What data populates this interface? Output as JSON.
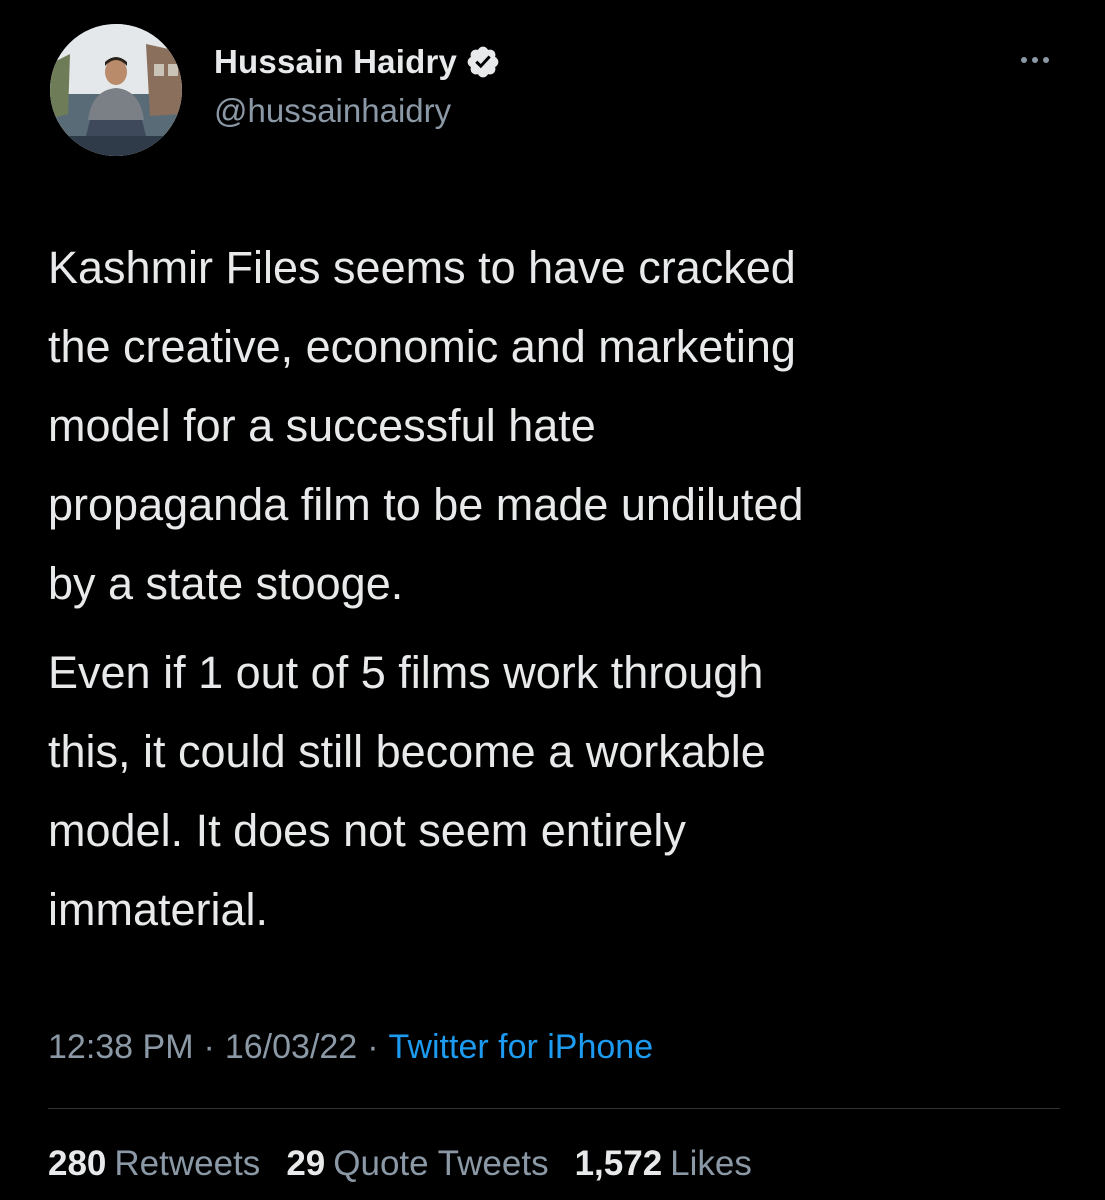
{
  "author": {
    "display_name": "Hussain Haidry",
    "handle": "@hussainhaidry",
    "verified_icon": "verified-badge-icon"
  },
  "menu": {
    "icon": "more-options-icon"
  },
  "tweet": {
    "paragraphs": [
      "Kashmir Files seems to have cracked\nthe creative, economic and marketing\nmodel for a successful hate\npropaganda film to be made undiluted\nby a state stooge.",
      "Even if 1 out of 5 films work through\nthis, it could still become a workable\nmodel. It does not seem entirely\nimmaterial."
    ]
  },
  "meta": {
    "time": "12:38 PM",
    "separator": "·",
    "date": "16/03/22",
    "source": "Twitter for iPhone"
  },
  "stats": {
    "retweets": {
      "count": "280",
      "label": "Retweets"
    },
    "quote_tweets": {
      "count": "29",
      "label": "Quote Tweets"
    },
    "likes": {
      "count": "1,572",
      "label": "Likes"
    }
  },
  "colors": {
    "background": "#000000",
    "text": "#e7e9ea",
    "secondary": "#8b98a5",
    "link": "#1d9bf0",
    "divider": "#2f3336"
  }
}
